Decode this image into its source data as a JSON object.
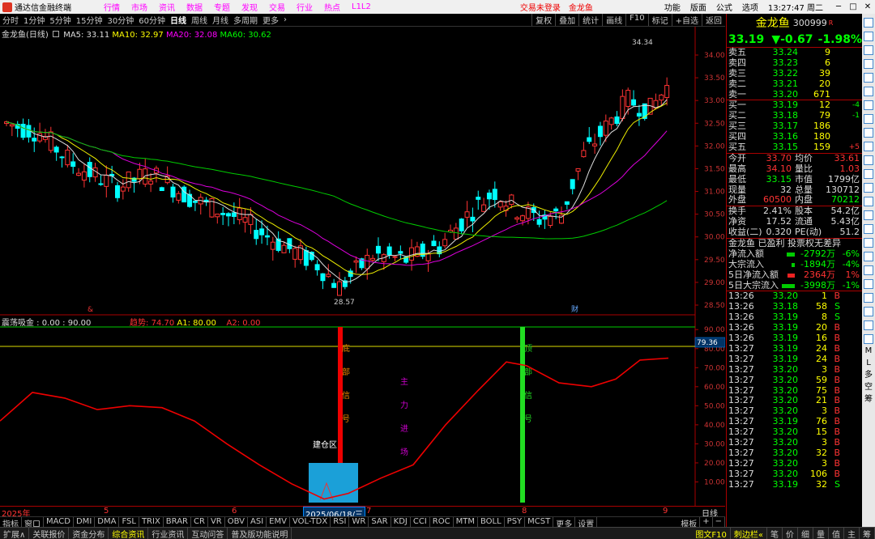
{
  "menubar": {
    "app": "通达信金融终端",
    "items": [
      "行情",
      "市场",
      "资讯",
      "数据",
      "专题",
      "发现",
      "交易",
      "行业",
      "热点",
      "L1L2"
    ],
    "warning": "交易未登录",
    "stock": "金龙鱼",
    "right_items": [
      "功能",
      "版面",
      "公式",
      "选项"
    ],
    "time": "13:27:47 周二",
    "win_buttons": [
      "─",
      "□",
      "✕"
    ]
  },
  "toolbar": {
    "periods": [
      "分时",
      "1分钟",
      "5分钟",
      "15分钟",
      "30分钟",
      "60分钟",
      "日线",
      "周线",
      "月线",
      "多周期",
      "更多"
    ],
    "active": "日线",
    "right": [
      "复权",
      "叠加",
      "统计",
      "画线",
      "F10",
      "标记",
      "+自选",
      "返回"
    ]
  },
  "main_legend": {
    "name": "金龙鱼(日线)",
    "ma5": "MA5: 33.11",
    "ma10": "MA10: 32.97",
    "ma20": "MA20: 32.08",
    "ma60": "MA60: 30.62"
  },
  "main_annotations": {
    "high": "34.34",
    "low": "28.57",
    "marker1": "&",
    "marker2": "财"
  },
  "ind_legend": {
    "name": "震荡吸金 : 0.00 : 90.00",
    "trend": "趋势: 74.70",
    "a1": "A1: 80.00",
    "a2": "A2: 0.00",
    "current": "79.36"
  },
  "ind_text": {
    "bottom_signal": [
      "底",
      "部",
      "信",
      "号"
    ],
    "main_force": [
      "主",
      "力",
      "进",
      "场"
    ],
    "top_signal": [
      "顶",
      "部",
      "信",
      "号"
    ],
    "build_zone": "建仓区"
  },
  "price_axis": [
    "34.00",
    "33.50",
    "33.00",
    "32.50",
    "32.00",
    "31.50",
    "31.00",
    "30.50",
    "30.00",
    "29.50",
    "29.00",
    "28.50"
  ],
  "ind_axis": [
    "90.00",
    "80.00",
    "70.00",
    "60.00",
    "50.00",
    "40.00",
    "30.00",
    "20.00",
    "10.00"
  ],
  "time_axis": {
    "labels": [
      "2025年",
      "5",
      "6",
      "7",
      "8",
      "9"
    ],
    "cursor": "2025/06/18/三",
    "right": "日线"
  },
  "indicator_tabs": [
    "指标",
    "窗口",
    "MACD",
    "DMI",
    "DMA",
    "FSL",
    "TRIX",
    "BRAR",
    "CR",
    "VR",
    "OBV",
    "ASI",
    "EMV",
    "VOL-TDX",
    "RSI",
    "WR",
    "SAR",
    "KDJ",
    "CCI",
    "ROC",
    "MTM",
    "BOLL",
    "PSY",
    "MCST",
    "更多",
    "设置"
  ],
  "indicator_tabs_right": [
    "模板",
    "+",
    "−"
  ],
  "bottom_bar": [
    "扩展∧",
    "关联报价",
    "资金分布",
    "综合资讯",
    "行业资讯",
    "互动问答",
    "普及版功能说明"
  ],
  "bottom_bar_hi": "综合资讯",
  "bottom_right": [
    "图文F10",
    "刺边栏«",
    "笔",
    "价",
    "细",
    "量",
    "值",
    "主",
    "筹"
  ],
  "quote": {
    "name": "金龙鱼",
    "code": "300999",
    "tag": "R",
    "price": "33.19",
    "change": "▼-0.67",
    "pct": "-1.98%",
    "asks": [
      {
        "label": "卖五",
        "price": "33.24",
        "vol": "9"
      },
      {
        "label": "卖四",
        "price": "33.23",
        "vol": "6"
      },
      {
        "label": "卖三",
        "price": "33.22",
        "vol": "39"
      },
      {
        "label": "卖二",
        "price": "33.21",
        "vol": "20"
      },
      {
        "label": "卖一",
        "price": "33.20",
        "vol": "671"
      }
    ],
    "bids": [
      {
        "label": "买一",
        "price": "33.19",
        "vol": "12",
        "chg": "-4"
      },
      {
        "label": "买二",
        "price": "33.18",
        "vol": "79",
        "chg": "-1"
      },
      {
        "label": "买三",
        "price": "33.17",
        "vol": "186",
        "chg": ""
      },
      {
        "label": "买四",
        "price": "33.16",
        "vol": "180",
        "chg": ""
      },
      {
        "label": "买五",
        "price": "33.15",
        "vol": "159",
        "chg": "+5"
      }
    ],
    "stats": [
      {
        "l1": "今开",
        "v1": "33.70",
        "l2": "均价",
        "v2": "33.61"
      },
      {
        "l1": "最高",
        "v1": "34.10",
        "l2": "量比",
        "v2": "1.03"
      },
      {
        "l1": "最低",
        "v1": "33.15",
        "l2": "市值",
        "v2": "1799亿"
      },
      {
        "l1": "现量",
        "v1": "32",
        "l2": "总量",
        "v2": "130712"
      },
      {
        "l1": "外盘",
        "v1": "60500",
        "l2": "内盘",
        "v2": "70212"
      }
    ],
    "stats2": [
      {
        "l1": "换手",
        "v1": "2.41%",
        "l2": "股本",
        "v2": "54.2亿"
      },
      {
        "l1": "净资",
        "v1": "17.52",
        "l2": "流通",
        "v2": "5.43亿"
      },
      {
        "l1": "收益(二)",
        "v1": "0.320",
        "l2": "PE(动)",
        "v2": "51.2"
      }
    ],
    "info": "金龙鱼 已盈利 投票权无差异",
    "flows": [
      {
        "label": "净流入额",
        "value": "-2792万",
        "pct": "-6%",
        "bar": 0.55,
        "color": "#0c0"
      },
      {
        "label": "大宗流入",
        "value": "-1894万",
        "pct": "-4%",
        "bar": 0.2,
        "color": "#0c0"
      },
      {
        "label": "5日净流入额",
        "value": "2364万",
        "pct": "1%",
        "bar": 0.5,
        "color": "#e22"
      },
      {
        "label": "5日大宗流入",
        "value": "-3998万",
        "pct": "-1%",
        "bar": 0.9,
        "color": "#0c0"
      }
    ],
    "ticks": [
      {
        "t": "13:26",
        "p": "33.20",
        "v": "1",
        "s": "B"
      },
      {
        "t": "13:26",
        "p": "33.18",
        "v": "58",
        "s": "S"
      },
      {
        "t": "13:26",
        "p": "33.19",
        "v": "8",
        "s": "S"
      },
      {
        "t": "13:26",
        "p": "33.19",
        "v": "20",
        "s": "B"
      },
      {
        "t": "13:26",
        "p": "33.19",
        "v": "16",
        "s": "B"
      },
      {
        "t": "13:27",
        "p": "33.19",
        "v": "24",
        "s": "B"
      },
      {
        "t": "13:27",
        "p": "33.19",
        "v": "24",
        "s": "B"
      },
      {
        "t": "13:27",
        "p": "33.20",
        "v": "3",
        "s": "B"
      },
      {
        "t": "13:27",
        "p": "33.20",
        "v": "59",
        "s": "B"
      },
      {
        "t": "13:27",
        "p": "33.20",
        "v": "75",
        "s": "B"
      },
      {
        "t": "13:27",
        "p": "33.20",
        "v": "21",
        "s": "B"
      },
      {
        "t": "13:27",
        "p": "33.20",
        "v": "3",
        "s": "B"
      },
      {
        "t": "13:27",
        "p": "33.19",
        "v": "76",
        "s": "B"
      },
      {
        "t": "13:27",
        "p": "33.20",
        "v": "15",
        "s": "B"
      },
      {
        "t": "13:27",
        "p": "33.20",
        "v": "3",
        "s": "B"
      },
      {
        "t": "13:27",
        "p": "33.20",
        "v": "32",
        "s": "B"
      },
      {
        "t": "13:27",
        "p": "33.20",
        "v": "3",
        "s": "B"
      },
      {
        "t": "13:27",
        "p": "33.20",
        "v": "106",
        "s": "B"
      },
      {
        "t": "13:27",
        "p": "33.19",
        "v": "32",
        "s": "S"
      }
    ]
  },
  "side_strip_text": [
    "M",
    "L",
    "多",
    "空",
    "筹"
  ]
}
